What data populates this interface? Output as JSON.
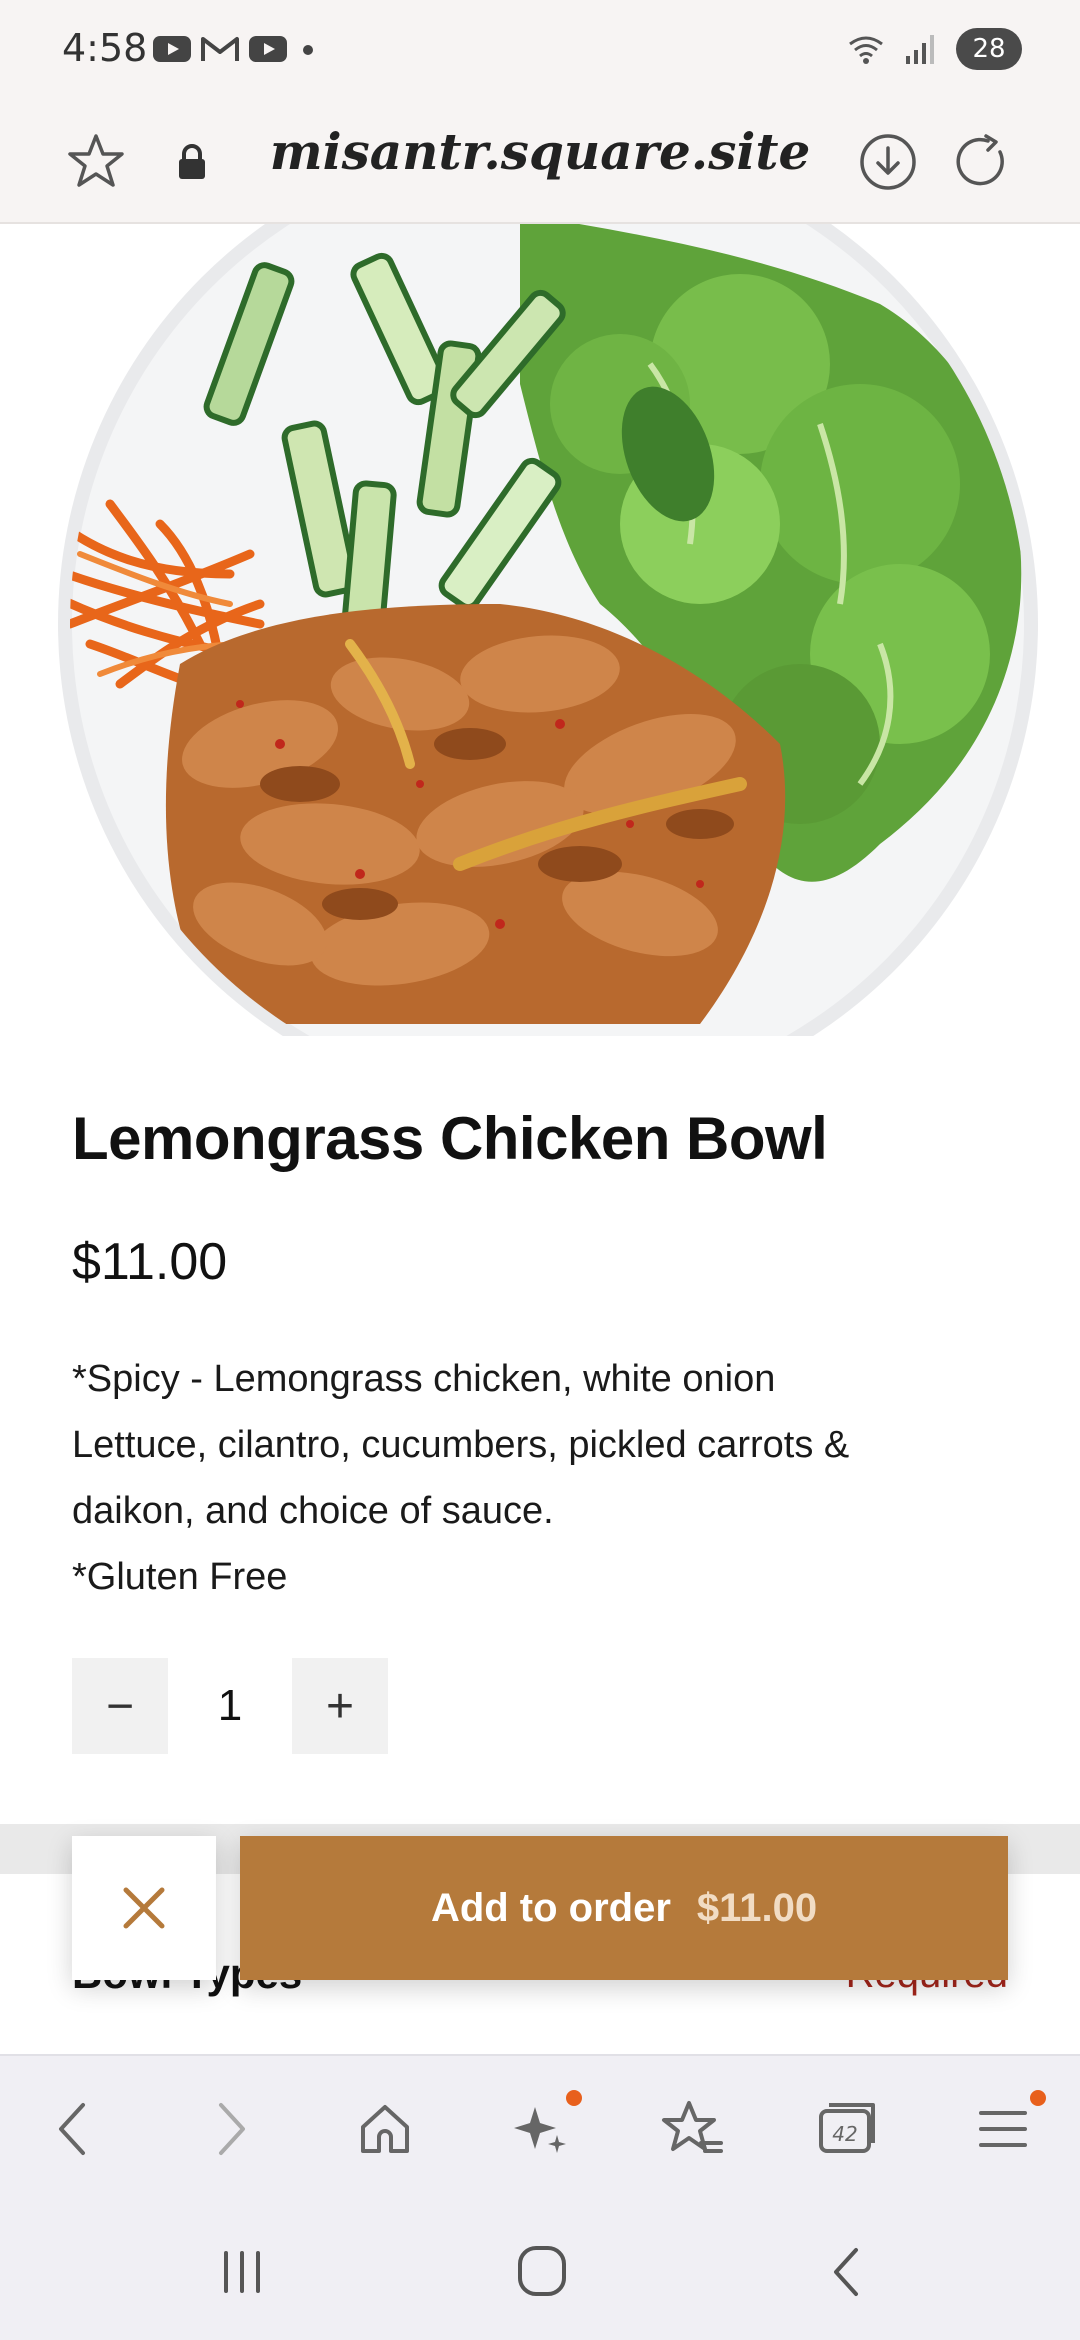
{
  "status_bar": {
    "time": "4:58",
    "battery": "28",
    "app_icons": [
      "youtube-icon",
      "gmail-icon",
      "youtube-icon",
      "dot-icon"
    ],
    "system_icons": [
      "wifi-icon",
      "signal-icon"
    ]
  },
  "browser": {
    "url": "misantr.square.site",
    "left_icons": [
      "star-icon",
      "lock-icon"
    ],
    "right_icons": [
      "download-icon",
      "reload-icon"
    ]
  },
  "product": {
    "title": "Lemongrass Chicken Bowl",
    "price": "$11.00",
    "description_lines": [
      "*Spicy - Lemongrass chicken, white onion",
      "Lettuce, cilantro, cucumbers, pickled carrots &",
      "daikon, and choice of sauce.",
      "*Gluten Free"
    ]
  },
  "quantity": {
    "decrement": "−",
    "value": "1",
    "increment": "+"
  },
  "options_section": {
    "title": "Bowl Types",
    "required": "Required"
  },
  "action_bar": {
    "close_icon": "close-icon",
    "add_label": "Add to order",
    "add_price": "$11.00"
  },
  "browser_nav": {
    "items": [
      "back-icon",
      "forward-icon",
      "home-icon",
      "sparkle-icon",
      "bookmarks-icon",
      "tabs-icon",
      "menu-icon"
    ],
    "tabs_count": "42"
  },
  "system_nav": {
    "items": [
      "recents-icon",
      "home-icon",
      "back-icon"
    ]
  },
  "colors": {
    "accent": "#b57a3b",
    "required": "#a3251b",
    "notification_dot": "#e8601c"
  }
}
